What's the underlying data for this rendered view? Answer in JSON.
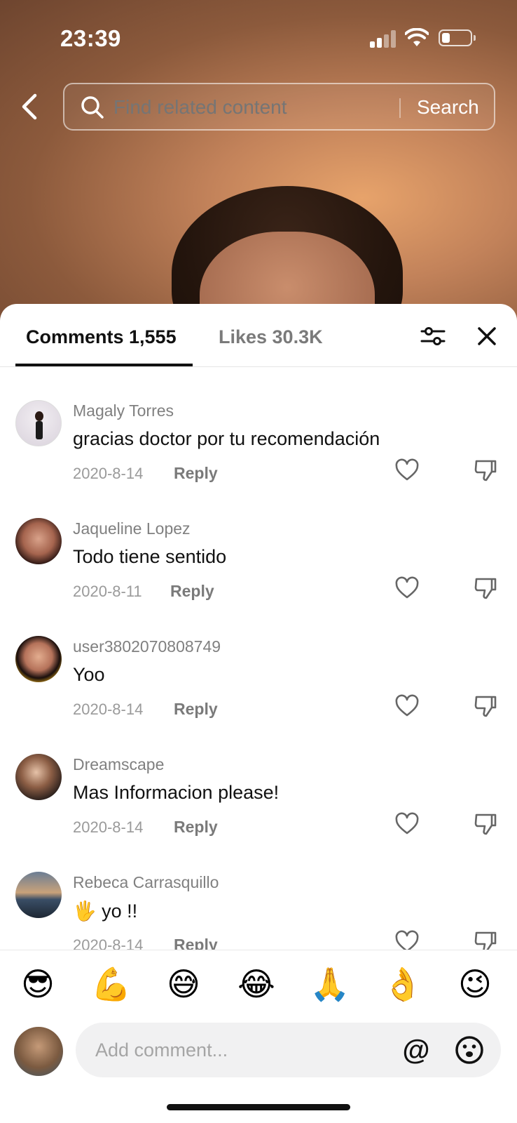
{
  "status_bar": {
    "time": "23:39"
  },
  "search": {
    "placeholder": "Find related content",
    "button_label": "Search"
  },
  "tabs": {
    "comments_label": "Comments 1,555",
    "likes_label": "Likes 30.3K"
  },
  "comments": [
    {
      "user": "Magaly Torres",
      "text": "gracias doctor por tu recomendación",
      "date": "2020-8-14",
      "reply": "Reply"
    },
    {
      "user": "Jaqueline Lopez",
      "text": "Todo tiene sentido",
      "date": "2020-8-11",
      "reply": "Reply"
    },
    {
      "user": "user3802070808749",
      "text": "Yoo",
      "date": "2020-8-14",
      "reply": "Reply"
    },
    {
      "user": "Dreamscape",
      "text": "Mas Informacion please!",
      "date": "2020-8-14",
      "reply": "Reply"
    },
    {
      "user": "Rebeca Carrasquillo",
      "text": "🖐️ yo !!",
      "date": "2020-8-14",
      "reply": "Reply"
    }
  ],
  "emoji_bar": [
    "😎",
    "💪",
    "😅",
    "😂",
    "🙏",
    "👌",
    "😉"
  ],
  "composer": {
    "placeholder": "Add comment...",
    "mention_symbol": "@"
  },
  "icons": {
    "back": "chevron-left-icon",
    "search": "search-icon",
    "filter": "sliders-icon",
    "close": "close-icon",
    "like": "heart-icon",
    "dislike": "thumbs-down-icon",
    "emoji": "smile-icon"
  },
  "colors": {
    "sheet_bg": "#ffffff",
    "text_primary": "#111111",
    "text_secondary": "#808080",
    "input_bg": "#f1f1f2"
  }
}
